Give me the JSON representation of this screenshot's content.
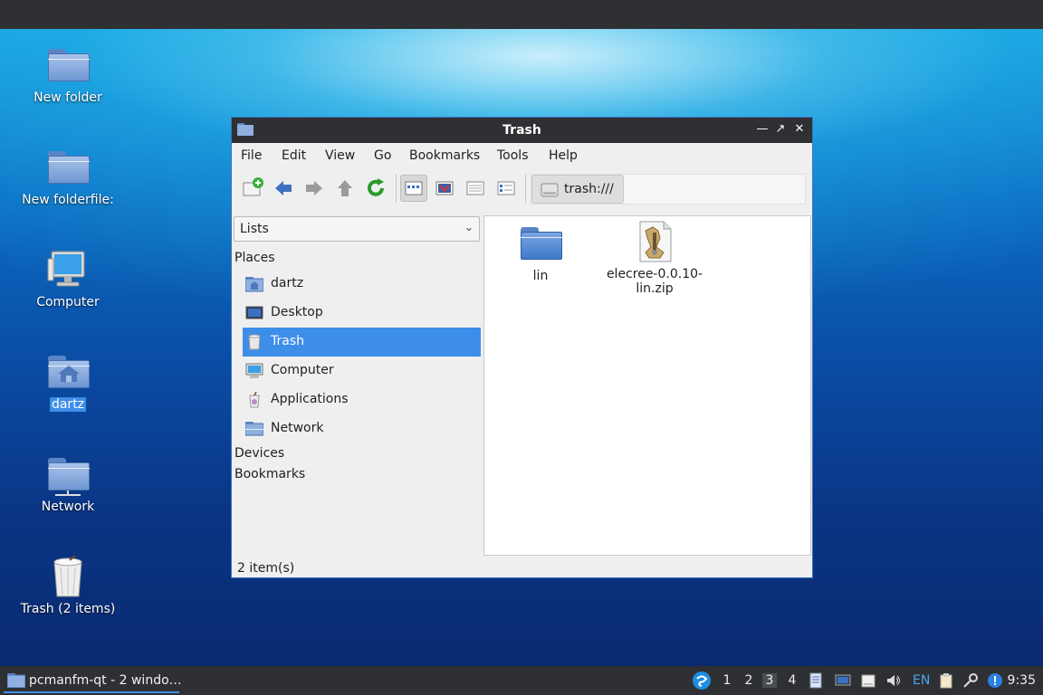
{
  "desktop": {
    "icons": [
      {
        "label": "New folder",
        "icon": "folder-icon"
      },
      {
        "label": "New folderfile:",
        "icon": "folder-icon"
      },
      {
        "label": "Computer",
        "icon": "computer-icon"
      },
      {
        "label": "dartz",
        "icon": "home-folder-icon",
        "selected": true
      },
      {
        "label": "Network",
        "icon": "network-icon"
      },
      {
        "label": "Trash (2 items)",
        "icon": "trash-icon"
      }
    ]
  },
  "window": {
    "title": "Trash",
    "menu": [
      "File",
      "Edit",
      "View",
      "Go",
      "Bookmarks",
      "Tools",
      "Help"
    ],
    "toolbar": {
      "buttons": [
        "new-tab-icon",
        "back-arrow-icon",
        "forward-arrow-icon",
        "up-arrow-icon",
        "reload-icon",
        "icon-view-icon",
        "thumbnail-view-icon",
        "compact-view-icon",
        "detailed-list-view-icon"
      ],
      "path": "trash:///"
    },
    "side_panel": {
      "mode": "Lists",
      "places_header": "Places",
      "places": [
        {
          "label": "dartz",
          "icon": "home-folder-icon"
        },
        {
          "label": "Desktop",
          "icon": "desktop-icon"
        },
        {
          "label": "Trash",
          "icon": "trash-icon",
          "selected": true
        },
        {
          "label": "Computer",
          "icon": "computer-icon"
        },
        {
          "label": "Applications",
          "icon": "applications-icon"
        },
        {
          "label": "Network",
          "icon": "network-folder-icon"
        }
      ],
      "devices_header": "Devices",
      "bookmarks_header": "Bookmarks"
    },
    "files": [
      {
        "name": "lin",
        "icon": "folder-icon"
      },
      {
        "name_line1": "elecree-0.0.10-",
        "name_line2": "lin.zip",
        "icon": "zip-archive-icon"
      }
    ],
    "status": "2 item(s)"
  },
  "taskbar": {
    "task": "pcmanfm-qt - 2 windo…",
    "workspaces": [
      "1",
      "2",
      "3",
      "4"
    ],
    "active_workspace": "3",
    "keyboard_layout": "EN",
    "clock": "9:35"
  },
  "colors": {
    "selection": "#3d8ee8",
    "panel": "#2e3033"
  }
}
